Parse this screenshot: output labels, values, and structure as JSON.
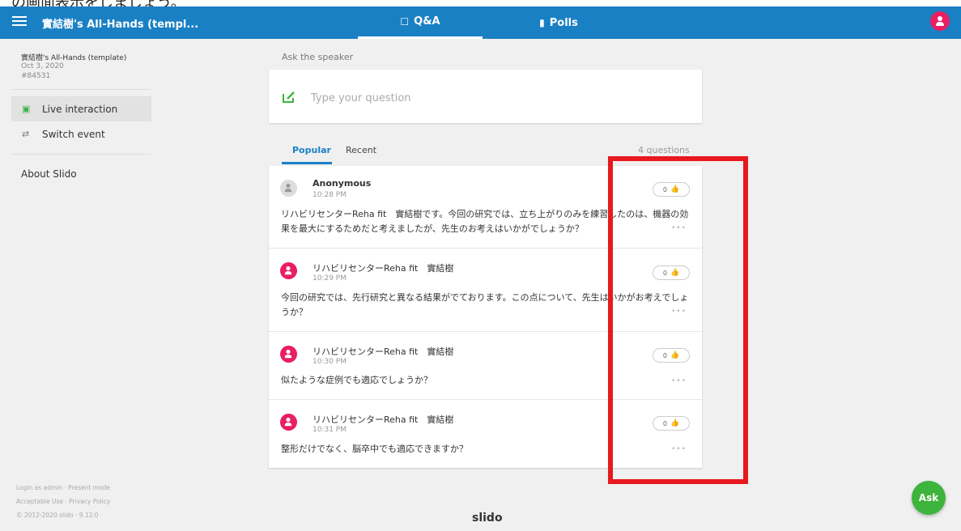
{
  "overlay": {
    "text": "の画面表示をしましょう。"
  },
  "topbar": {
    "event_title": "實結樹's All-Hands (templ...",
    "tabs": [
      {
        "label": "Q&A",
        "icon": "chat-icon"
      },
      {
        "label": "Polls",
        "icon": "bar-chart-icon"
      }
    ]
  },
  "sidebar": {
    "event_name": "實結樹's All-Hands (template)",
    "event_date": "Oct 3, 2020",
    "event_code": "#84531",
    "items": [
      {
        "label": "Live interaction",
        "icon": "live-interaction-icon"
      },
      {
        "label": "Switch event",
        "icon": "switch-icon"
      }
    ],
    "about": "About Slido",
    "footer": [
      "Login as admin · Present mode",
      "Acceptable Use · Privacy Policy",
      "© 2012-2020 slido · 9.12.0"
    ]
  },
  "ask": {
    "label": "Ask the speaker",
    "placeholder": "Type your question"
  },
  "questions_tabs": {
    "popular": "Popular",
    "recent": "Recent",
    "count": "4 questions"
  },
  "questions": [
    {
      "name": "Anonymous",
      "time": "10:28 PM",
      "text": "リハビリセンターReha fit　實結樹です。今回の研究では、立ち上がりのみを練習したのは、機器の効果を最大にするためだと考えましたが、先生のお考えはいかがでしょうか？",
      "likes": "0",
      "avatar": "anonymous"
    },
    {
      "name": "リハビリセンターReha fit　實結樹",
      "time": "10:29 PM",
      "text": "今回の研究では、先行研究と異なる結果がでております。この点について、先生はいかがお考えでしょうか？",
      "likes": "0",
      "avatar": "user"
    },
    {
      "name": "リハビリセンターReha fit　實結樹",
      "time": "10:30 PM",
      "text": "似たような症例でも適応でしょうか？",
      "likes": "0",
      "avatar": "user"
    },
    {
      "name": "リハビリセンターReha fit　實結樹",
      "time": "10:31 PM",
      "text": "整形だけでなく、脳卒中でも適応できますか？",
      "likes": "0",
      "avatar": "user"
    }
  ],
  "brand": "slido",
  "fab": {
    "label": "Ask"
  },
  "colors": {
    "topbar": "#1a80c4",
    "accent": "#3db43c",
    "avatar": "#e91e63",
    "highlight": "#e8191e"
  }
}
